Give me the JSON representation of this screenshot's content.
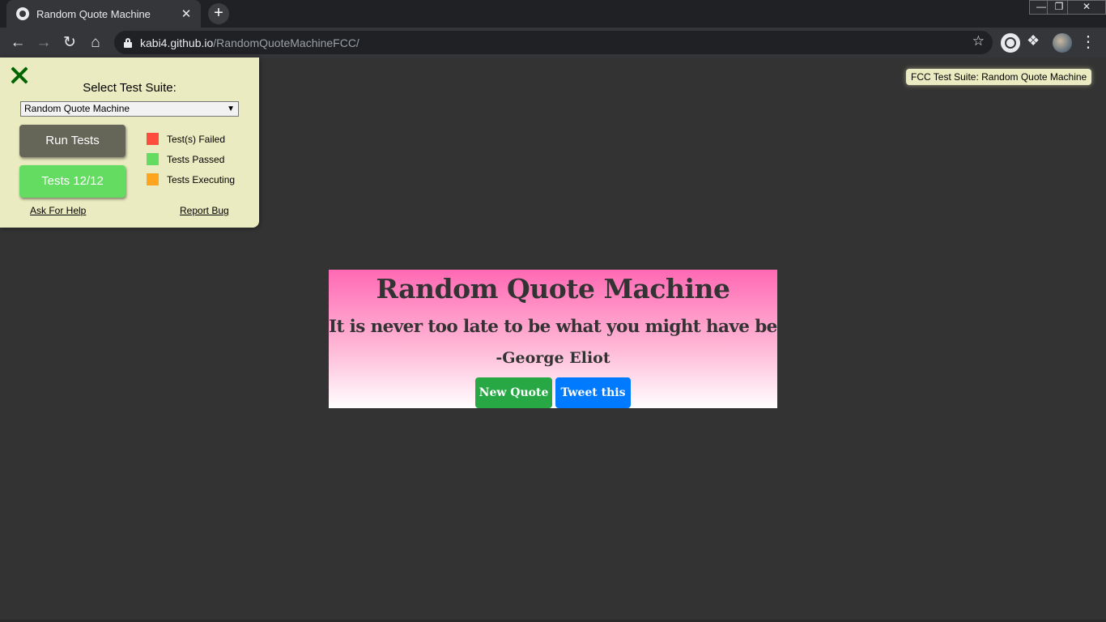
{
  "browser": {
    "tab_title": "Random Quote Machine",
    "tab_close": "✕",
    "new_tab": "+",
    "url_host": "kabi4.github.io",
    "url_path": "/RandomQuoteMachineFCC/",
    "window_minimize": "—",
    "window_maximize": "❐",
    "window_close": "✕"
  },
  "fcc": {
    "select_label": "Select Test Suite:",
    "selected_suite": "Random Quote Machine",
    "run_tests": "Run Tests",
    "tests_count": "Tests 12/12",
    "legend": [
      {
        "label": "Test(s) Failed",
        "color": "#ff4d3d"
      },
      {
        "label": "Tests Passed",
        "color": "#64dc61"
      },
      {
        "label": "Tests Executing",
        "color": "#ffa41f"
      }
    ],
    "ask_help": "Ask For Help",
    "report_bug": "Report Bug",
    "tooltip": "FCC Test Suite: Random Quote Machine"
  },
  "quote_box": {
    "title": "Random Quote Machine",
    "text": "It is never too late to be what you might have been.",
    "author": "-George Eliot",
    "new_quote": "New Quote",
    "tweet": "Tweet this"
  },
  "colors": {
    "page_bg": "#333333",
    "panel_bg": "#ebebc1",
    "new_quote_bg": "#28a745",
    "tweet_bg": "#007bff"
  }
}
